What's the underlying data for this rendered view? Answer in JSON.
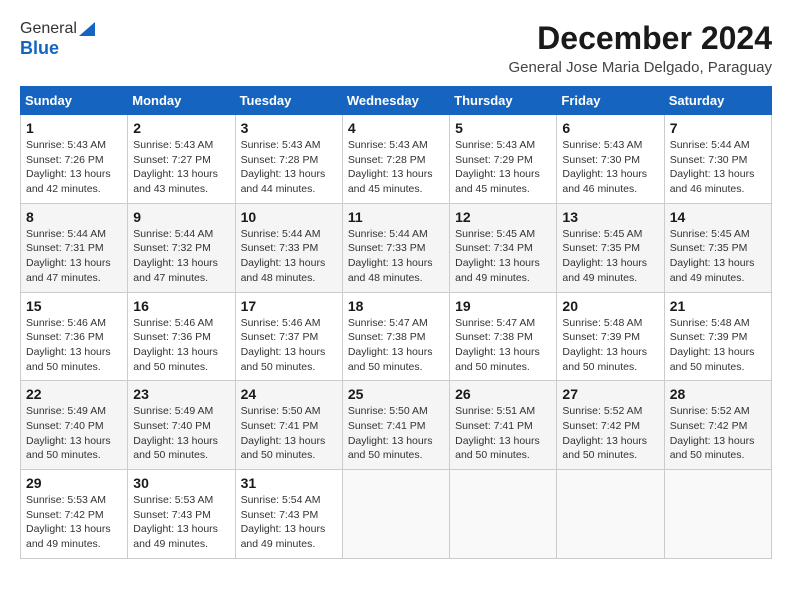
{
  "logo": {
    "general": "General",
    "blue": "Blue"
  },
  "title": "December 2024",
  "location": "General Jose Maria Delgado, Paraguay",
  "days_of_week": [
    "Sunday",
    "Monday",
    "Tuesday",
    "Wednesday",
    "Thursday",
    "Friday",
    "Saturday"
  ],
  "weeks": [
    [
      {
        "day": "1",
        "sunrise": "5:43 AM",
        "sunset": "7:26 PM",
        "daylight": "13 hours and 42 minutes."
      },
      {
        "day": "2",
        "sunrise": "5:43 AM",
        "sunset": "7:27 PM",
        "daylight": "13 hours and 43 minutes."
      },
      {
        "day": "3",
        "sunrise": "5:43 AM",
        "sunset": "7:28 PM",
        "daylight": "13 hours and 44 minutes."
      },
      {
        "day": "4",
        "sunrise": "5:43 AM",
        "sunset": "7:28 PM",
        "daylight": "13 hours and 45 minutes."
      },
      {
        "day": "5",
        "sunrise": "5:43 AM",
        "sunset": "7:29 PM",
        "daylight": "13 hours and 45 minutes."
      },
      {
        "day": "6",
        "sunrise": "5:43 AM",
        "sunset": "7:30 PM",
        "daylight": "13 hours and 46 minutes."
      },
      {
        "day": "7",
        "sunrise": "5:44 AM",
        "sunset": "7:30 PM",
        "daylight": "13 hours and 46 minutes."
      }
    ],
    [
      {
        "day": "8",
        "sunrise": "5:44 AM",
        "sunset": "7:31 PM",
        "daylight": "13 hours and 47 minutes."
      },
      {
        "day": "9",
        "sunrise": "5:44 AM",
        "sunset": "7:32 PM",
        "daylight": "13 hours and 47 minutes."
      },
      {
        "day": "10",
        "sunrise": "5:44 AM",
        "sunset": "7:33 PM",
        "daylight": "13 hours and 48 minutes."
      },
      {
        "day": "11",
        "sunrise": "5:44 AM",
        "sunset": "7:33 PM",
        "daylight": "13 hours and 48 minutes."
      },
      {
        "day": "12",
        "sunrise": "5:45 AM",
        "sunset": "7:34 PM",
        "daylight": "13 hours and 49 minutes."
      },
      {
        "day": "13",
        "sunrise": "5:45 AM",
        "sunset": "7:35 PM",
        "daylight": "13 hours and 49 minutes."
      },
      {
        "day": "14",
        "sunrise": "5:45 AM",
        "sunset": "7:35 PM",
        "daylight": "13 hours and 49 minutes."
      }
    ],
    [
      {
        "day": "15",
        "sunrise": "5:46 AM",
        "sunset": "7:36 PM",
        "daylight": "13 hours and 50 minutes."
      },
      {
        "day": "16",
        "sunrise": "5:46 AM",
        "sunset": "7:36 PM",
        "daylight": "13 hours and 50 minutes."
      },
      {
        "day": "17",
        "sunrise": "5:46 AM",
        "sunset": "7:37 PM",
        "daylight": "13 hours and 50 minutes."
      },
      {
        "day": "18",
        "sunrise": "5:47 AM",
        "sunset": "7:38 PM",
        "daylight": "13 hours and 50 minutes."
      },
      {
        "day": "19",
        "sunrise": "5:47 AM",
        "sunset": "7:38 PM",
        "daylight": "13 hours and 50 minutes."
      },
      {
        "day": "20",
        "sunrise": "5:48 AM",
        "sunset": "7:39 PM",
        "daylight": "13 hours and 50 minutes."
      },
      {
        "day": "21",
        "sunrise": "5:48 AM",
        "sunset": "7:39 PM",
        "daylight": "13 hours and 50 minutes."
      }
    ],
    [
      {
        "day": "22",
        "sunrise": "5:49 AM",
        "sunset": "7:40 PM",
        "daylight": "13 hours and 50 minutes."
      },
      {
        "day": "23",
        "sunrise": "5:49 AM",
        "sunset": "7:40 PM",
        "daylight": "13 hours and 50 minutes."
      },
      {
        "day": "24",
        "sunrise": "5:50 AM",
        "sunset": "7:41 PM",
        "daylight": "13 hours and 50 minutes."
      },
      {
        "day": "25",
        "sunrise": "5:50 AM",
        "sunset": "7:41 PM",
        "daylight": "13 hours and 50 minutes."
      },
      {
        "day": "26",
        "sunrise": "5:51 AM",
        "sunset": "7:41 PM",
        "daylight": "13 hours and 50 minutes."
      },
      {
        "day": "27",
        "sunrise": "5:52 AM",
        "sunset": "7:42 PM",
        "daylight": "13 hours and 50 minutes."
      },
      {
        "day": "28",
        "sunrise": "5:52 AM",
        "sunset": "7:42 PM",
        "daylight": "13 hours and 50 minutes."
      }
    ],
    [
      {
        "day": "29",
        "sunrise": "5:53 AM",
        "sunset": "7:42 PM",
        "daylight": "13 hours and 49 minutes."
      },
      {
        "day": "30",
        "sunrise": "5:53 AM",
        "sunset": "7:43 PM",
        "daylight": "13 hours and 49 minutes."
      },
      {
        "day": "31",
        "sunrise": "5:54 AM",
        "sunset": "7:43 PM",
        "daylight": "13 hours and 49 minutes."
      },
      null,
      null,
      null,
      null
    ]
  ],
  "labels": {
    "sunrise": "Sunrise:",
    "sunset": "Sunset:",
    "daylight": "Daylight:"
  }
}
